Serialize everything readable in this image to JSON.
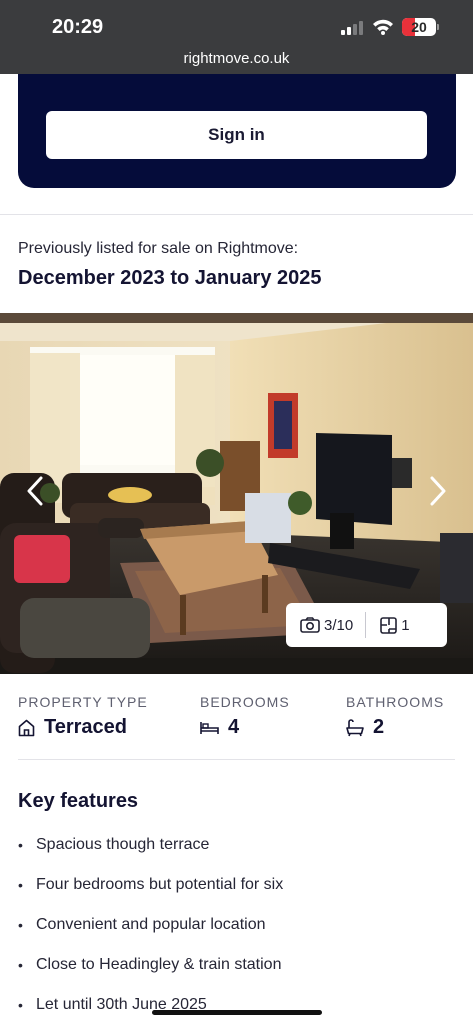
{
  "status_bar": {
    "time": "20:29",
    "battery_level": "20",
    "battery_color": "#e8313a",
    "signal_icon": "cellular-signal-icon",
    "wifi_icon": "wifi-icon"
  },
  "browser": {
    "url": "rightmove.co.uk"
  },
  "signin": {
    "button_label": "Sign in",
    "card_color": "#050c3a"
  },
  "listing_history": {
    "label": "Previously listed for sale on Rightmove:",
    "dates": "December 2023 to January 2025"
  },
  "gallery": {
    "photo_counter": "3/10",
    "floorplan_count": "1",
    "prev_icon": "chevron-left-icon",
    "next_icon": "chevron-right-icon",
    "camera_icon": "camera-icon",
    "floorplan_icon": "floorplan-icon"
  },
  "facts": {
    "property_type_label": "PROPERTY TYPE",
    "property_type_value": "Terraced",
    "property_type_icon": "house-icon",
    "bedrooms_label": "BEDROOMS",
    "bedrooms_value": "4",
    "bedrooms_icon": "bed-icon",
    "bathrooms_label": "BATHROOMS",
    "bathrooms_value": "2",
    "bathrooms_icon": "bath-icon"
  },
  "key_features": {
    "title": "Key features",
    "items": [
      "Spacious though terrace",
      "Four bedrooms but potential for six",
      "Convenient and popular location",
      "Close to Headingley & train station",
      "Let until 30th June 2025"
    ]
  }
}
